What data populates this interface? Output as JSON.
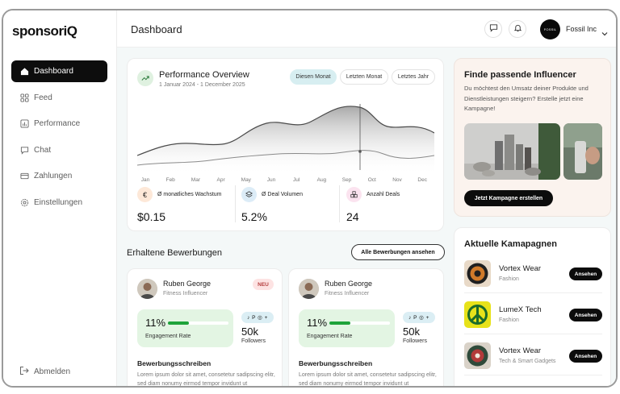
{
  "brand": {
    "logo_text": "sponsoriQ"
  },
  "sidebar": {
    "items": [
      {
        "label": "Dashboard",
        "icon": "home-icon",
        "active": true
      },
      {
        "label": "Feed",
        "icon": "grid-icon",
        "active": false
      },
      {
        "label": "Performance",
        "icon": "chart-icon",
        "active": false
      },
      {
        "label": "Chat",
        "icon": "chat-icon",
        "active": false
      },
      {
        "label": "Zahlungen",
        "icon": "card-icon",
        "active": false
      },
      {
        "label": "Einstellungen",
        "icon": "gear-icon",
        "active": false
      }
    ],
    "logout_label": "Abmelden"
  },
  "header": {
    "title": "Dashboard",
    "company": "Fossil Inc",
    "avatar_text": "FOSSIL"
  },
  "performance": {
    "title": "Performance Overview",
    "date_range": "1 Januar 2024 - 1 December 2025",
    "tabs": [
      "Diesen Monat",
      "Letzten Monat",
      "Letztes Jahr"
    ],
    "months": [
      "Jan",
      "Feb",
      "Mar",
      "Apr",
      "May",
      "Jun",
      "Jul",
      "Aug",
      "Sep",
      "Oct",
      "Nov",
      "Dec"
    ],
    "stats": [
      {
        "label": "Ø monatliches Wachstum",
        "value": "$0.15",
        "icon": "euro-icon",
        "color": "#fde8d8"
      },
      {
        "label": "Ø Deal Volumen",
        "value": "5.2%",
        "icon": "layers-icon",
        "color": "#dcecf7"
      },
      {
        "label": "Anzahl Deals",
        "value": "24",
        "icon": "shapes-icon",
        "color": "#fbe3ef"
      }
    ]
  },
  "promo": {
    "title": "Finde passende Influencer",
    "text": "Du möchtest den Umsatz deiner Produkte und Dienstleistungen steigern? Erstelle jetzt eine Kampagne!",
    "button": "Jetzt Kampagne erstellen"
  },
  "applications": {
    "title": "Erhaltene Bewerbungen",
    "all_button": "Alle Bewerbungen ansehen",
    "items": [
      {
        "name": "Ruben George",
        "role": "Fitness Influencer",
        "badge": "NEU",
        "engagement": "11%",
        "engagement_label": "Engagement Rate",
        "engagement_fill": 0.35,
        "followers": "50k",
        "followers_label": "Followers",
        "socials": "♪ P ◎ +",
        "section": "Bewerbungsschreiben",
        "text": "Lorem ipsum dolor sit amet, consetetur sadipscing elitr, sed diam nonumy eirmod tempor invidunt ut"
      },
      {
        "name": "Ruben George",
        "role": "Fitness Influencer",
        "badge": "",
        "engagement": "11%",
        "engagement_label": "Engagement Rate",
        "engagement_fill": 0.35,
        "followers": "50k",
        "followers_label": "Followers",
        "socials": "♪ P ◎ +",
        "section": "Bewerbungsschreiben",
        "text": "Lorem ipsum dolor sit amet, consetetur sadipscing elitr, sed diam nonumy eirmod tempor invidunt ut"
      }
    ]
  },
  "campaigns": {
    "title": "Aktuelle Kamapagnen",
    "items": [
      {
        "name": "Vortex Wear",
        "category": "Fashion",
        "button": "Ansehen"
      },
      {
        "name": "LumeX Tech",
        "category": "Fashion",
        "button": "Ansehen"
      },
      {
        "name": "Vortex Wear",
        "category": "Tech & Smart Gadgets",
        "button": "Ansehen"
      }
    ]
  }
}
